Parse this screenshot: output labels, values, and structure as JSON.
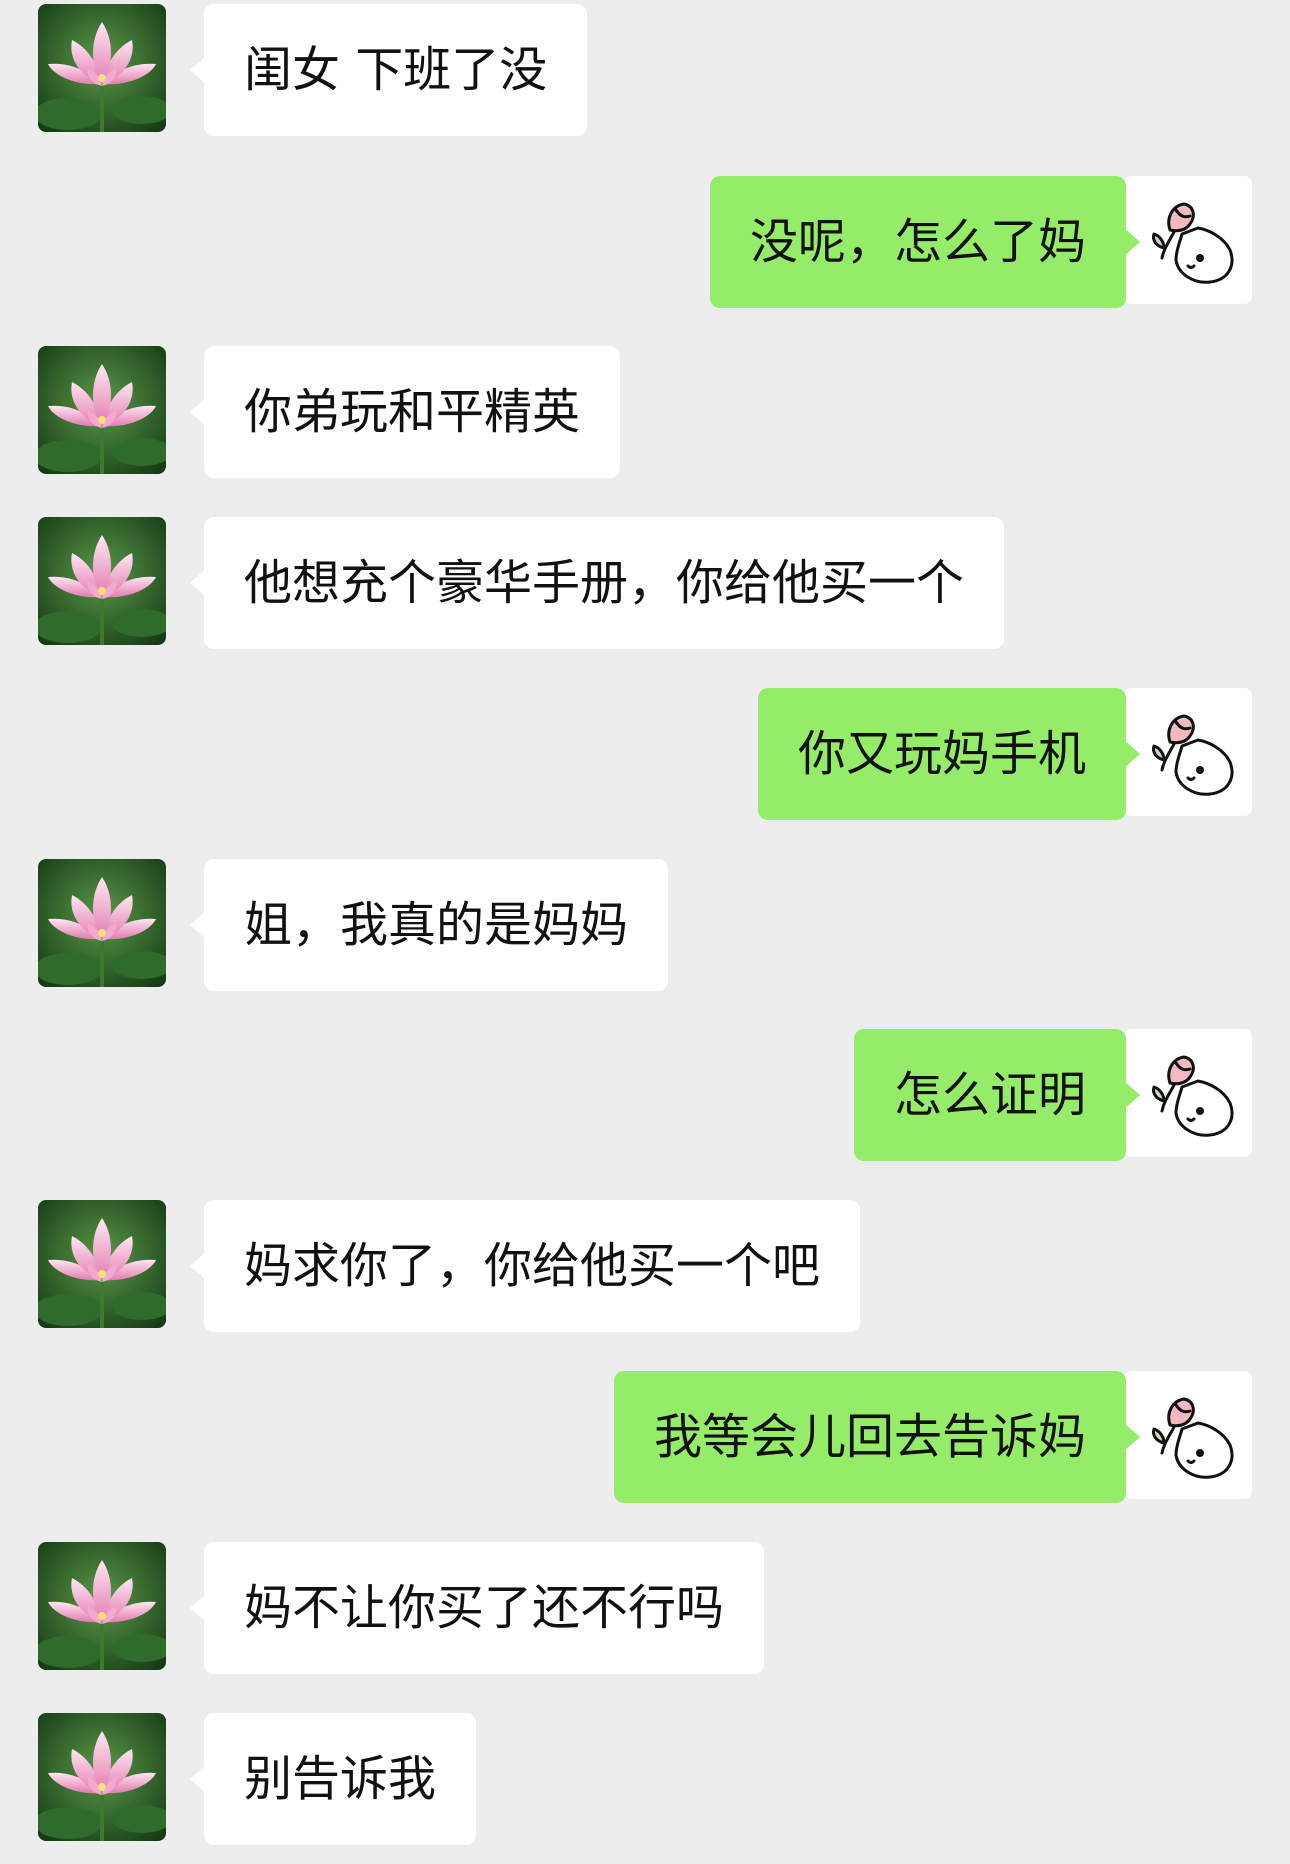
{
  "colors": {
    "background": "#ededed",
    "incoming_bubble": "#ffffff",
    "outgoing_bubble": "#95ec69",
    "text": "#111111"
  },
  "contact_avatar": {
    "icon": "lotus-flower-icon"
  },
  "self_avatar": {
    "icon": "rose-cat-doodle-icon"
  },
  "messages": [
    {
      "side": "left",
      "text": "闺女 下班了没"
    },
    {
      "side": "right",
      "text": "没呢，怎么了妈"
    },
    {
      "side": "left",
      "text": "你弟玩和平精英"
    },
    {
      "side": "left",
      "text": "他想充个豪华手册，你给他买一个"
    },
    {
      "side": "right",
      "text": "你又玩妈手机"
    },
    {
      "side": "left",
      "text": "姐，我真的是妈妈"
    },
    {
      "side": "right",
      "text": "怎么证明"
    },
    {
      "side": "left",
      "text": "妈求你了，你给他买一个吧"
    },
    {
      "side": "right",
      "text": "我等会儿回去告诉妈"
    },
    {
      "side": "left",
      "text": "妈不让你买了还不行吗"
    },
    {
      "side": "left",
      "text": "别告诉我"
    }
  ]
}
